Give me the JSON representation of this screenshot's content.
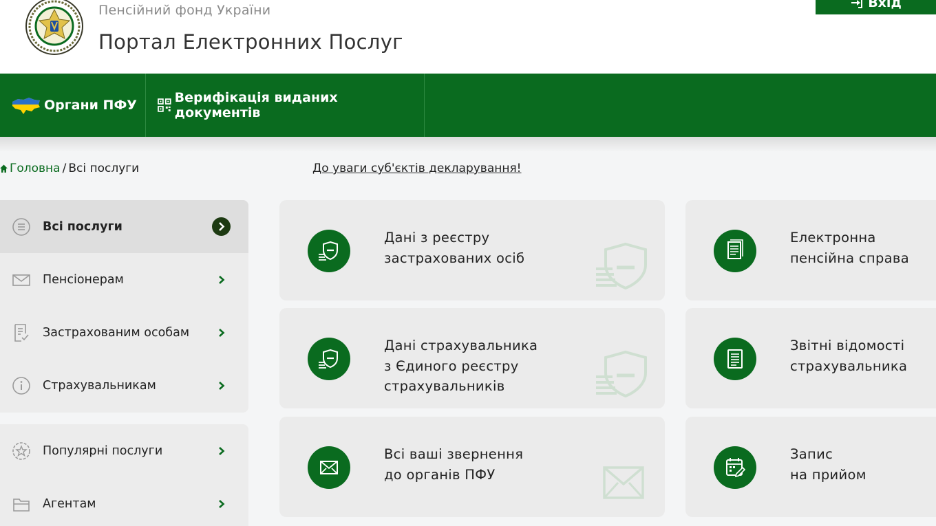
{
  "header": {
    "org_name": "Пенсійний фонд України",
    "portal_title": "Портал Електронних Послуг",
    "login_label": "Вхід"
  },
  "nav": {
    "items": [
      {
        "label": "Органи ПФУ",
        "icon": "ukraine-map-icon"
      },
      {
        "label": "Верифікація виданих документів",
        "icon": "qr-code-icon"
      }
    ]
  },
  "breadcrumb": {
    "home": "Головна",
    "separator": "/",
    "current": "Всі послуги"
  },
  "notice_link": "До уваги суб'єктів декларування!",
  "sidebar": {
    "group1": [
      {
        "label": "Всі послуги",
        "icon": "list-icon",
        "active": true
      },
      {
        "label": "Пенсіонерам",
        "icon": "envelope-icon"
      },
      {
        "label": "Застрахованим особам",
        "icon": "document-check-icon"
      },
      {
        "label": "Страхувальникам",
        "icon": "info-icon"
      }
    ],
    "group2": [
      {
        "label": "Популярні послуги",
        "icon": "star-badge-icon"
      },
      {
        "label": "Агентам",
        "icon": "folder-icon"
      }
    ]
  },
  "cards": [
    {
      "lines": [
        "Дані з реєстру",
        "застрахованих осіб"
      ],
      "icon": "shield-coins-icon"
    },
    {
      "lines": [
        "Електронна",
        "пенсійна справа"
      ],
      "icon": "document-stack-icon"
    },
    {
      "lines": [
        "Дані страхувальника",
        "з Єдиного реєстру",
        "страхувальників"
      ],
      "icon": "shield-coins-icon"
    },
    {
      "lines": [
        "Звітні відомості",
        "страхувальника"
      ],
      "icon": "report-list-icon"
    },
    {
      "lines": [
        "Всі ваші звернення",
        "до органів ПФУ"
      ],
      "icon": "envelope-icon"
    },
    {
      "lines": [
        "Запис",
        "на прийом"
      ],
      "icon": "calendar-edit-icon"
    }
  ],
  "colors": {
    "brand_green": "#0a6b1f",
    "dark_chevron": "#1d3a12",
    "card_bg": "#ebebeb",
    "sidebar_bg": "#ececec"
  }
}
